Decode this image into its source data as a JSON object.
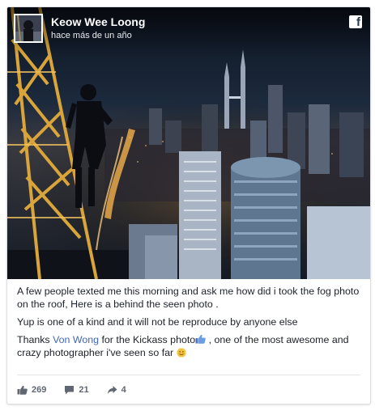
{
  "post": {
    "author": "Keow Wee Loong",
    "timestamp": "hace más de un año",
    "brand_icon": "facebook-f-icon",
    "paragraph1": "A few people texted me this morning and ask me how did i took the fog photo on the roof, Here is a behind the seen photo .",
    "paragraph2": "Yup is one of a kind and it will not be reproduce by anyone else",
    "paragraph3_prefix": "Thanks ",
    "paragraph3_link": "Von Wong",
    "paragraph3_middle": " for the Kickass photo",
    "paragraph3_after_emoji": " , one of the most awesome and crazy photographer i've seen so far ",
    "link_color": "#4267b2"
  },
  "stats": {
    "likes": "269",
    "comments": "21",
    "shares": "4",
    "like_icon": "thumbs-up-icon",
    "comment_icon": "comment-bubble-icon",
    "share_icon": "share-arrow-icon"
  }
}
